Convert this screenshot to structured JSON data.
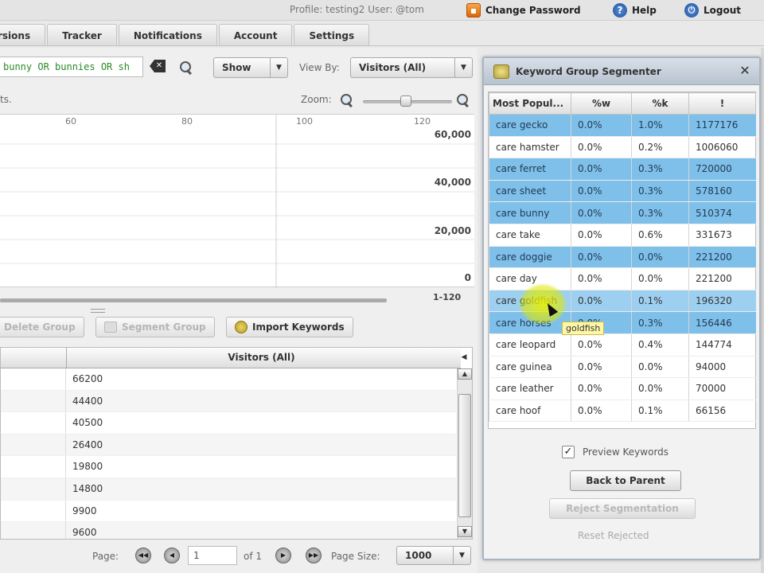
{
  "header": {
    "profile": "Profile: testing2 User: @tom",
    "change_password": "Change Password",
    "help": "Help",
    "logout": "Logout"
  },
  "tabs": [
    "rsions",
    "Tracker",
    "Notifications",
    "Account",
    "Settings"
  ],
  "toolbar": {
    "search_value": "bunny OR bunnies OR sh",
    "show_label": "Show",
    "view_by_label": "View By:",
    "view_by_value": "Visitors (All)",
    "zoom_label": "Zoom:",
    "chart_caption": "ts."
  },
  "chart": {
    "x_ticks": [
      "60",
      "80",
      "100",
      "120"
    ],
    "y_ticks": [
      "60,000",
      "40,000",
      "20,000",
      "0"
    ],
    "range_label": "1-120"
  },
  "actions": {
    "delete_group": "Delete Group",
    "segment_group": "Segment Group",
    "import_keywords": "Import Keywords"
  },
  "grid": {
    "column_header": "Visitors (All)",
    "values": [
      "66200",
      "44400",
      "40500",
      "26400",
      "19800",
      "14800",
      "9900",
      "9600"
    ]
  },
  "pager": {
    "page_label": "Page:",
    "page_value": "1",
    "of_label": "of 1",
    "page_size_label": "Page Size:",
    "page_size_value": "1000"
  },
  "segmenter": {
    "title": "Keyword Group Segmenter",
    "columns": [
      "Most Popul...",
      "%w",
      "%k",
      "!"
    ],
    "rows": [
      {
        "keyword": "care gecko",
        "w": "0.0%",
        "k": "1.0%",
        "n": "1177176",
        "state": "selected"
      },
      {
        "keyword": "care hamster",
        "w": "0.0%",
        "k": "0.2%",
        "n": "1006060",
        "state": ""
      },
      {
        "keyword": "care ferret",
        "w": "0.0%",
        "k": "0.3%",
        "n": "720000",
        "state": "selected"
      },
      {
        "keyword": "care sheet",
        "w": "0.0%",
        "k": "0.3%",
        "n": "578160",
        "state": "selected"
      },
      {
        "keyword": "care bunny",
        "w": "0.0%",
        "k": "0.3%",
        "n": "510374",
        "state": "selected"
      },
      {
        "keyword": "care take",
        "w": "0.0%",
        "k": "0.6%",
        "n": "331673",
        "state": ""
      },
      {
        "keyword": "care doggie",
        "w": "0.0%",
        "k": "0.0%",
        "n": "221200",
        "state": "selected"
      },
      {
        "keyword": "care day",
        "w": "0.0%",
        "k": "0.0%",
        "n": "221200",
        "state": ""
      },
      {
        "keyword": "care goldfish",
        "w": "0.0%",
        "k": "0.1%",
        "n": "196320",
        "state": "hover"
      },
      {
        "keyword": "care horses",
        "w": "0.0%",
        "k": "0.3%",
        "n": "156446",
        "state": "selected"
      },
      {
        "keyword": "care leopard",
        "w": "0.0%",
        "k": "0.4%",
        "n": "144774",
        "state": ""
      },
      {
        "keyword": "care guinea",
        "w": "0.0%",
        "k": "0.0%",
        "n": "94000",
        "state": ""
      },
      {
        "keyword": "care leather",
        "w": "0.0%",
        "k": "0.0%",
        "n": "70000",
        "state": ""
      },
      {
        "keyword": "care hoof",
        "w": "0.0%",
        "k": "0.1%",
        "n": "66156",
        "state": ""
      }
    ],
    "tooltip": "goldfish",
    "preview_label": "Preview Keywords",
    "back_to_parent": "Back to Parent",
    "reject_segmentation": "Reject Segmentation",
    "reset_rejected": "Reset Rejected"
  },
  "colors": {
    "selected_row": "#7ec0ea",
    "search_text": "#2a8a2a",
    "accent_orange": "#e07a1a"
  }
}
